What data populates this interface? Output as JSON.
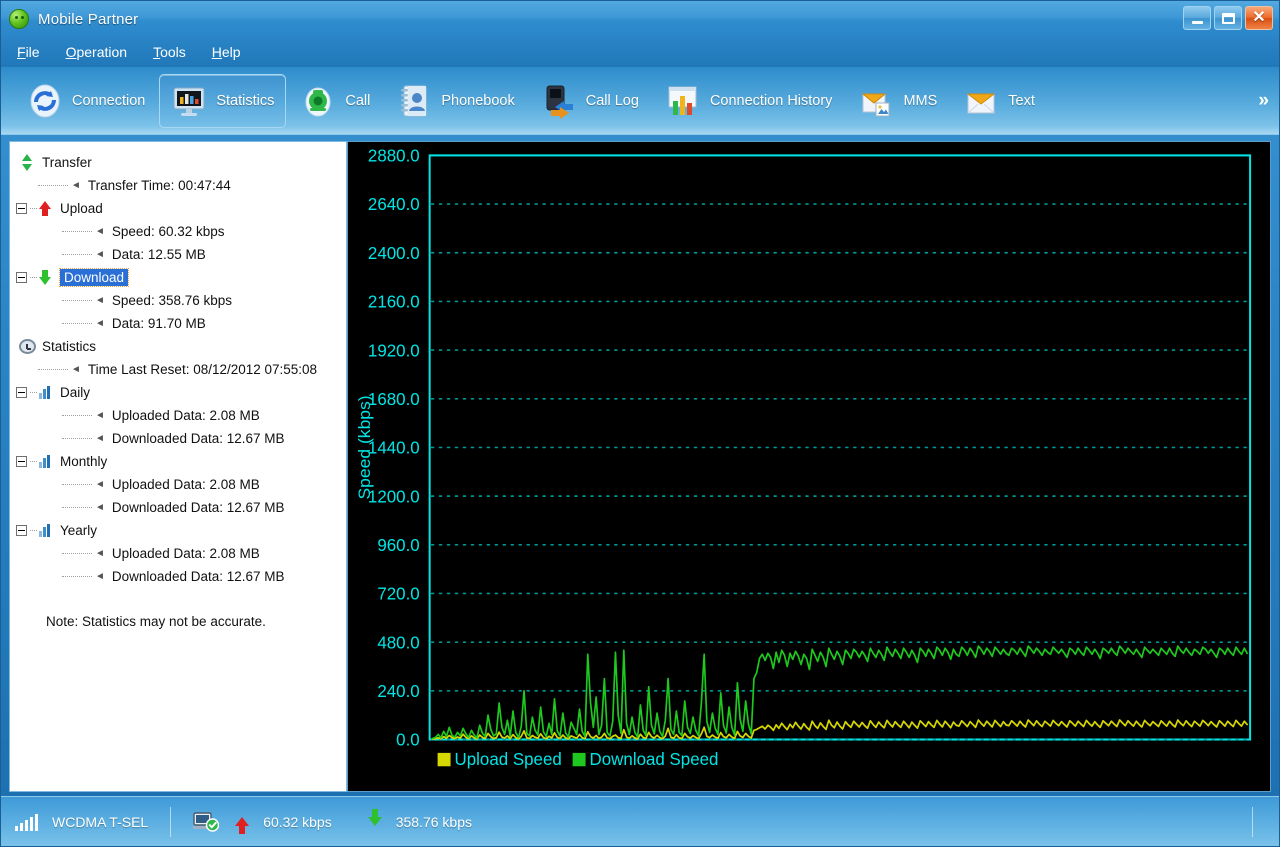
{
  "window": {
    "title": "Mobile Partner",
    "app_icon": "mobile-partner-icon",
    "minimize_label": "_",
    "maximize_label": "",
    "close_label": "✕"
  },
  "menubar": {
    "items": [
      {
        "label": "File",
        "accel": "F"
      },
      {
        "label": "Operation",
        "accel": "O"
      },
      {
        "label": "Tools",
        "accel": "T"
      },
      {
        "label": "Help",
        "accel": "H"
      }
    ]
  },
  "toolbar": {
    "overflow_label": "»",
    "items": [
      {
        "label": "Connection",
        "icon": "connection-refresh-icon",
        "active": false
      },
      {
        "label": "Statistics",
        "icon": "statistics-monitor-icon",
        "active": true
      },
      {
        "label": "Call",
        "icon": "call-phone-icon",
        "active": false
      },
      {
        "label": "Phonebook",
        "icon": "phonebook-contact-icon",
        "active": false
      },
      {
        "label": "Call Log",
        "icon": "call-log-icon",
        "active": false
      },
      {
        "label": "Connection History",
        "icon": "connection-history-chart-icon",
        "active": false
      },
      {
        "label": "MMS",
        "icon": "mms-envelope-icon",
        "active": false
      },
      {
        "label": "Text",
        "icon": "text-envelope-icon",
        "active": false
      }
    ]
  },
  "tree": {
    "note": "Note: Statistics may not be accurate.",
    "nodes": [
      {
        "label": "Transfer",
        "icon": "transfer-arrows-icon",
        "level": 0,
        "type": "root"
      },
      {
        "label": "Transfer Time: 00:47:44",
        "level": 1,
        "type": "leaf"
      },
      {
        "label": "Upload",
        "icon": "upload-arrow-icon",
        "level": 0,
        "type": "branch"
      },
      {
        "label": "Speed: 60.32 kbps",
        "level": 2,
        "type": "leaf"
      },
      {
        "label": "Data: 12.55 MB",
        "level": 2,
        "type": "leaf-last"
      },
      {
        "label": "Download",
        "icon": "download-arrow-icon",
        "level": 0,
        "type": "branch",
        "selected": true
      },
      {
        "label": "Speed: 358.76 kbps",
        "level": 2,
        "type": "leaf"
      },
      {
        "label": "Data: 91.70 MB",
        "level": 2,
        "type": "leaf-last"
      },
      {
        "label": "Statistics",
        "icon": "clock-icon",
        "level": 0,
        "type": "root"
      },
      {
        "label": "Time Last Reset: 08/12/2012 07:55:08",
        "level": 1,
        "type": "leaf"
      },
      {
        "label": "Daily",
        "icon": "bar-chart-icon",
        "level": 0,
        "type": "branch"
      },
      {
        "label": "Uploaded Data: 2.08 MB",
        "level": 2,
        "type": "leaf"
      },
      {
        "label": "Downloaded Data: 12.67 MB",
        "level": 2,
        "type": "leaf-last"
      },
      {
        "label": "Monthly",
        "icon": "bar-chart-icon",
        "level": 0,
        "type": "branch"
      },
      {
        "label": "Uploaded Data: 2.08 MB",
        "level": 2,
        "type": "leaf"
      },
      {
        "label": "Downloaded Data: 12.67 MB",
        "level": 2,
        "type": "leaf-last"
      },
      {
        "label": "Yearly",
        "icon": "bar-chart-icon",
        "level": 0,
        "type": "branch"
      },
      {
        "label": "Uploaded Data: 2.08 MB",
        "level": 2,
        "type": "leaf"
      },
      {
        "label": "Downloaded Data: 12.67 MB",
        "level": 2,
        "type": "leaf-last"
      }
    ]
  },
  "chart_data": {
    "type": "line",
    "title": "",
    "xlabel": "",
    "ylabel": "Speed (kbps)",
    "ylim": [
      0,
      2880
    ],
    "yticks": [
      0,
      240,
      480,
      720,
      960,
      1200,
      1440,
      1680,
      1920,
      2160,
      2400,
      2640,
      2880
    ],
    "ytick_labels": [
      "0.0",
      "240.0",
      "480.0",
      "720.0",
      "960.0",
      "1200.0",
      "1440.0",
      "1680.0",
      "1920.0",
      "2160.0",
      "2400.0",
      "2640.0",
      "2880.0"
    ],
    "xticks": [],
    "xtick_labels": [],
    "grid": true,
    "grid_style": "dotted",
    "grid_color": "#00a0a0",
    "background": "#000000",
    "axis_color": "#00e5e5",
    "legend_position": "bottom-left",
    "legend": [
      {
        "name": "Upload Speed",
        "color": "#d7d700"
      },
      {
        "name": "Download Speed",
        "color": "#1ec81e"
      }
    ],
    "series": [
      {
        "name": "Upload Speed",
        "color": "#d7d700",
        "values": [
          2,
          4,
          8,
          3,
          14,
          6,
          20,
          9,
          5,
          12,
          7,
          26,
          11,
          4,
          18,
          8,
          3,
          22,
          10,
          6,
          30,
          14,
          5,
          9,
          36,
          12,
          7,
          18,
          4,
          24,
          9,
          3,
          15,
          42,
          8,
          5,
          20,
          11,
          6,
          28,
          9,
          4,
          16,
          7,
          33,
          10,
          5,
          22,
          8,
          3,
          18,
          12,
          6,
          25,
          9,
          4,
          38,
          14,
          7,
          20,
          5,
          11,
          30,
          8,
          4,
          16,
          22,
          9,
          5,
          48,
          12,
          6,
          18,
          8,
          3,
          26,
          10,
          5,
          35,
          14,
          7,
          21,
          9,
          4,
          17,
          55,
          11,
          6,
          23,
          8,
          5,
          30,
          13,
          7,
          19,
          10,
          4,
          28,
          60,
          16,
          9,
          22,
          11,
          6,
          34,
          14,
          8,
          25,
          12,
          5,
          40,
          18,
          10,
          30,
          15,
          7,
          45,
          50,
          58,
          65,
          52,
          70,
          61,
          45,
          72,
          55,
          80,
          63,
          49,
          75,
          58,
          85,
          66,
          52,
          78,
          60,
          47,
          90,
          68,
          55,
          82,
          64,
          50,
          95,
          70,
          58,
          86,
          66,
          52,
          88,
          72,
          60,
          90,
          75,
          62,
          84,
          68,
          56,
          92,
          74,
          60,
          86,
          70,
          58,
          94,
          76,
          62,
          88,
          72,
          60,
          90,
          74,
          58,
          86,
          70,
          56,
          92,
          78,
          64,
          88,
          72,
          60,
          94,
          76,
          62,
          90,
          74,
          58,
          86,
          70,
          66,
          92,
          78,
          64,
          88,
          74,
          60,
          96,
          80,
          66,
          90,
          76,
          62,
          94,
          78,
          64,
          88,
          72,
          68,
          92,
          80,
          66,
          90,
          74,
          62,
          96,
          82,
          68,
          92,
          76,
          64,
          90,
          78,
          66,
          94,
          80,
          68,
          88,
          74,
          62,
          92,
          80,
          66,
          90,
          76,
          64,
          94,
          78,
          66,
          88,
          72,
          60,
          92,
          80,
          68,
          90,
          76,
          64,
          96,
          82,
          68,
          92,
          78,
          66,
          90,
          74,
          62,
          94,
          80,
          68,
          88,
          76,
          64,
          92,
          78,
          66,
          90,
          74,
          62,
          96,
          80,
          68,
          92,
          76,
          64,
          90,
          78,
          66,
          94,
          82,
          68,
          88,
          74,
          62,
          92,
          80,
          66,
          90,
          76,
          64,
          94,
          78,
          66,
          90,
          74
        ]
      },
      {
        "name": "Download Speed",
        "color": "#1ec81e",
        "values": [
          5,
          10,
          25,
          8,
          40,
          15,
          60,
          20,
          12,
          35,
          18,
          55,
          28,
          10,
          45,
          22,
          8,
          70,
          30,
          15,
          120,
          50,
          18,
          28,
          180,
          60,
          25,
          95,
          15,
          140,
          35,
          10,
          65,
          240,
          30,
          18,
          110,
          45,
          22,
          160,
          38,
          15,
          80,
          25,
          200,
          42,
          18,
          130,
          32,
          12,
          85,
          55,
          25,
          150,
          40,
          15,
          420,
          180,
          60,
          210,
          25,
          70,
          300,
          35,
          18,
          90,
          430,
          120,
          30,
          440,
          80,
          25,
          110,
          35,
          12,
          170,
          45,
          20,
          260,
          70,
          28,
          130,
          40,
          15,
          95,
          300,
          50,
          25,
          140,
          35,
          20,
          190,
          60,
          30,
          110,
          45,
          18,
          180,
          420,
          90,
          35,
          130,
          55,
          25,
          230,
          70,
          32,
          160,
          60,
          22,
          280,
          100,
          40,
          190,
          75,
          28,
          300,
          330,
          400,
          420,
          390,
          425,
          405,
          350,
          430,
          380,
          440,
          415,
          360,
          425,
          395,
          435,
          410,
          370,
          420,
          400,
          345,
          445,
          415,
          385,
          430,
          405,
          360,
          450,
          420,
          395,
          435,
          410,
          370,
          440,
          425,
          400,
          445,
          430,
          405,
          435,
          415,
          385,
          450,
          425,
          405,
          440,
          420,
          390,
          455,
          430,
          410,
          445,
          425,
          400,
          450,
          430,
          405,
          440,
          415,
          380,
          450,
          435,
          410,
          445,
          425,
          400,
          455,
          440,
          415,
          450,
          430,
          395,
          445,
          420,
          410,
          455,
          440,
          415,
          450,
          430,
          405,
          460,
          445,
          420,
          450,
          435,
          410,
          455,
          440,
          420,
          445,
          425,
          415,
          450,
          440,
          420,
          450,
          430,
          410,
          460,
          445,
          425,
          450,
          435,
          415,
          445,
          430,
          420,
          455,
          440,
          425,
          445,
          425,
          405,
          450,
          440,
          420,
          450,
          430,
          415,
          455,
          440,
          420,
          445,
          425,
          400,
          450,
          440,
          425,
          450,
          430,
          415,
          460,
          445,
          425,
          450,
          435,
          420,
          445,
          425,
          405,
          455,
          440,
          425,
          445,
          430,
          415,
          450,
          435,
          420,
          450,
          425,
          410,
          460,
          440,
          425,
          450,
          430,
          415,
          445,
          435,
          420,
          455,
          445,
          425,
          445,
          425,
          405,
          450,
          440,
          420,
          450,
          430,
          415,
          455,
          435,
          420,
          450,
          425
        ]
      }
    ]
  },
  "statusbar": {
    "network_icon": "signal-bars-icon",
    "network_label": "WCDMA  T-SEL",
    "device_icon": "modem-connected-icon",
    "upload_icon": "upload-arrow-icon",
    "upload_speed": "60.32 kbps",
    "download_icon": "download-arrow-icon",
    "download_speed": "358.76 kbps"
  }
}
